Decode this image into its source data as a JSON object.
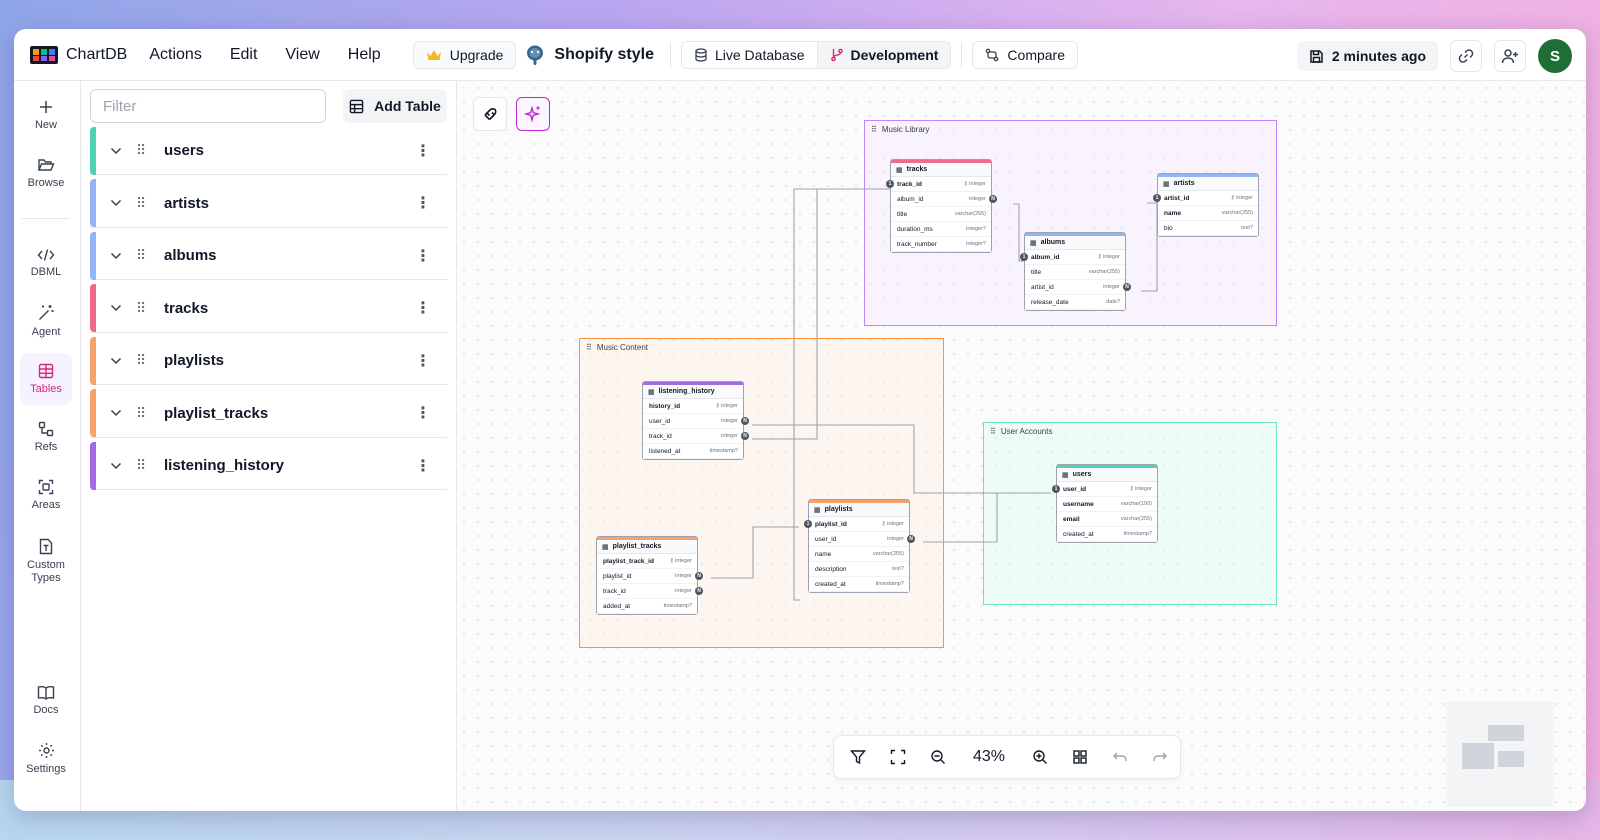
{
  "app": {
    "name": "ChartDB"
  },
  "menu": [
    "Actions",
    "Edit",
    "View",
    "Help"
  ],
  "header": {
    "upgrade_label": "Upgrade",
    "db_style_label": "Shopify style",
    "env_live_label": "Live Database",
    "env_dev_label": "Development",
    "compare_label": "Compare",
    "saved_label": "2 minutes ago",
    "avatar_initial": "S"
  },
  "rail": {
    "new": "New",
    "browse": "Browse",
    "dbml": "DBML",
    "agent": "Agent",
    "tables": "Tables",
    "refs": "Refs",
    "areas": "Areas",
    "custom_types": "Custom Types",
    "docs": "Docs",
    "settings": "Settings"
  },
  "panel": {
    "filter_placeholder": "Filter",
    "add_table_label": "Add Table",
    "tables": [
      {
        "name": "users",
        "color": "#4ed1b4"
      },
      {
        "name": "artists",
        "color": "#93b4f5"
      },
      {
        "name": "albums",
        "color": "#93b4f5"
      },
      {
        "name": "tracks",
        "color": "#f06b8b"
      },
      {
        "name": "playlists",
        "color": "#f7a26c"
      },
      {
        "name": "playlist_tracks",
        "color": "#f7a26c"
      },
      {
        "name": "listening_history",
        "color": "#a36be3"
      }
    ]
  },
  "canvas": {
    "areas": {
      "music_library": "Music Library",
      "music_content": "Music Content",
      "user_accounts": "User Accounts"
    },
    "db_tables": {
      "tracks": {
        "name": "tracks",
        "color": "#f06b8b",
        "fields": [
          {
            "n": "track_id",
            "t": "integer",
            "pk": true
          },
          {
            "n": "album_id",
            "t": "integer"
          },
          {
            "n": "title",
            "t": "varchar(255)"
          },
          {
            "n": "duration_ms",
            "t": "integer?"
          },
          {
            "n": "track_number",
            "t": "integer?"
          }
        ]
      },
      "artists": {
        "name": "artists",
        "color": "#93b4f5",
        "fields": [
          {
            "n": "artist_id",
            "t": "integer",
            "pk": true
          },
          {
            "n": "name",
            "t": "varchar(255)",
            "bold": true
          },
          {
            "n": "bio",
            "t": "text?"
          }
        ]
      },
      "albums": {
        "name": "albums",
        "color": "#93b4f5",
        "fields": [
          {
            "n": "album_id",
            "t": "integer",
            "pk": true
          },
          {
            "n": "title",
            "t": "varchar(255)"
          },
          {
            "n": "artist_id",
            "t": "integer"
          },
          {
            "n": "release_date",
            "t": "date?"
          }
        ]
      },
      "listening_history": {
        "name": "listening_history",
        "color": "#a36be3",
        "fields": [
          {
            "n": "history_id",
            "t": "integer",
            "pk": true
          },
          {
            "n": "user_id",
            "t": "integer"
          },
          {
            "n": "track_id",
            "t": "integer"
          },
          {
            "n": "listened_at",
            "t": "timestamp?"
          }
        ]
      },
      "playlists": {
        "name": "playlists",
        "color": "#f7a26c",
        "fields": [
          {
            "n": "playlist_id",
            "t": "integer",
            "pk": true
          },
          {
            "n": "user_id",
            "t": "integer"
          },
          {
            "n": "name",
            "t": "varchar(255)"
          },
          {
            "n": "description",
            "t": "text?"
          },
          {
            "n": "created_at",
            "t": "timestamp?"
          }
        ]
      },
      "playlist_tracks": {
        "name": "playlist_tracks",
        "color": "#f7a26c",
        "fields": [
          {
            "n": "playlist_track_id",
            "t": "integer",
            "pk": true
          },
          {
            "n": "playlist_id",
            "t": "integer"
          },
          {
            "n": "track_id",
            "t": "integer"
          },
          {
            "n": "added_at",
            "t": "timestamp?"
          }
        ]
      },
      "users": {
        "name": "users",
        "color": "#4ed1b4",
        "fields": [
          {
            "n": "user_id",
            "t": "integer",
            "pk": true
          },
          {
            "n": "username",
            "t": "varchar(100)",
            "bold": true
          },
          {
            "n": "email",
            "t": "varchar(255)",
            "bold": true
          },
          {
            "n": "created_at",
            "t": "timestamp?"
          }
        ]
      }
    },
    "rel_one": "1",
    "rel_many": "N"
  },
  "zoom": {
    "level": "43%"
  }
}
